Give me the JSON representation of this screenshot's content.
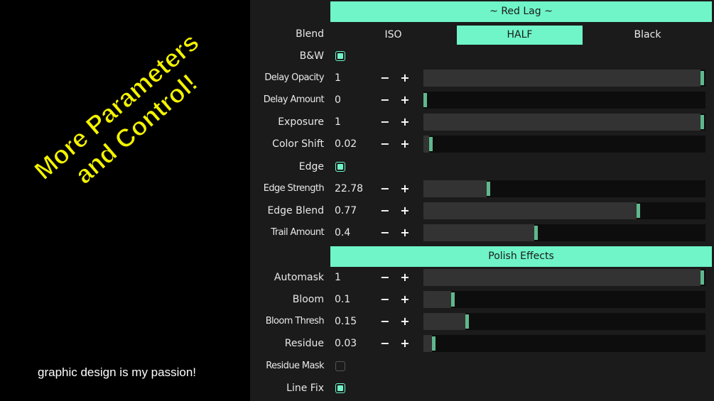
{
  "overlay": {
    "line1": "More Parameters",
    "line2": "and Control!",
    "caption": "graphic design is my passion!"
  },
  "colors": {
    "accent": "#6ff5c8",
    "knob": "#5fb88d",
    "overlay_text": "#f4f400"
  },
  "panel": {
    "section1_title": "~ Red Lag ~",
    "blend": {
      "label": "Blend",
      "options": [
        "ISO",
        "HALF",
        "Black"
      ],
      "selected": "HALF"
    },
    "bw": {
      "label": "B&W",
      "checked": true
    },
    "params1": [
      {
        "label": "Delay Opacity",
        "value": "1",
        "level": 1.0
      },
      {
        "label": "Delay Amount",
        "value": "0",
        "level": 0.0
      },
      {
        "label": "Exposure",
        "value": "1",
        "level": 1.0
      },
      {
        "label": "Color Shift",
        "value": "0.02",
        "level": 0.02
      }
    ],
    "edge": {
      "label": "Edge",
      "checked": true
    },
    "params2": [
      {
        "label": "Edge Strength",
        "value": "22.78",
        "level": 0.228
      },
      {
        "label": "Edge Blend",
        "value": "0.77",
        "level": 0.77
      },
      {
        "label": "Trail Amount",
        "value": "0.4",
        "level": 0.4
      }
    ],
    "section2_title": "Polish Effects",
    "params3": [
      {
        "label": "Automask",
        "value": "1",
        "level": 1.0
      },
      {
        "label": "Bloom",
        "value": "0.1",
        "level": 0.1
      },
      {
        "label": "Bloom Thresh",
        "value": "0.15",
        "level": 0.15
      },
      {
        "label": "Residue",
        "value": "0.03",
        "level": 0.03
      }
    ],
    "residue_mask": {
      "label": "Residue Mask",
      "checked": false
    },
    "line_fix": {
      "label": "Line Fix",
      "checked": true
    },
    "minus_symbol": "−",
    "plus_symbol": "+"
  }
}
